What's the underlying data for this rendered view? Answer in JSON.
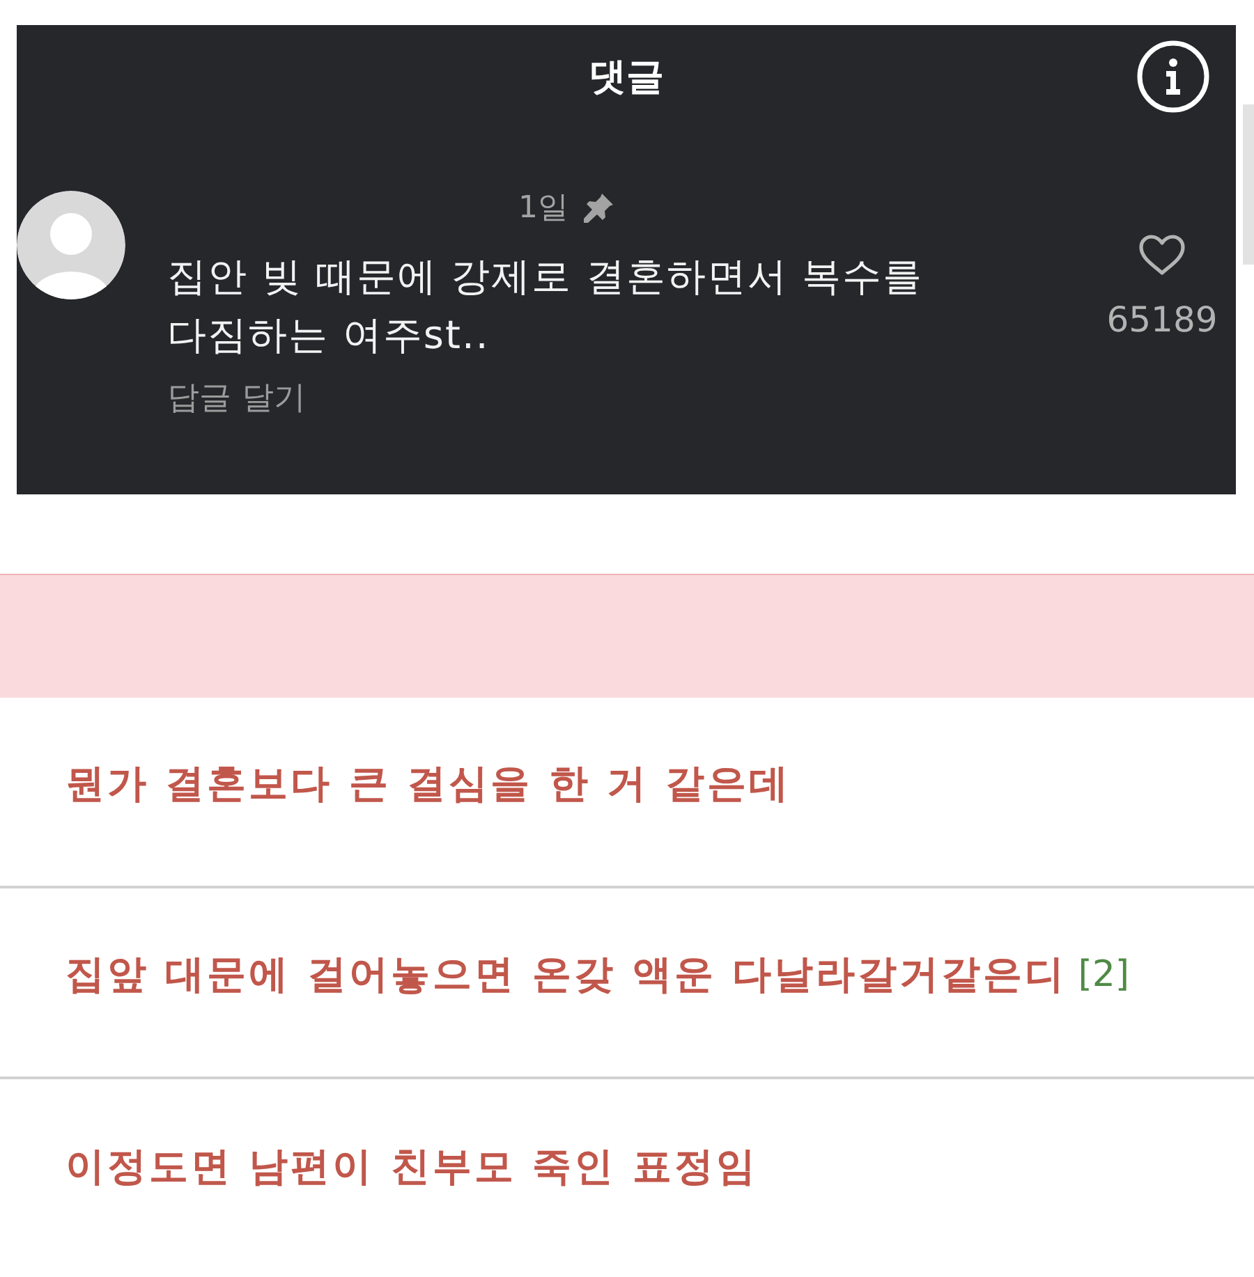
{
  "header": {
    "title": "댓글"
  },
  "comment": {
    "time": "1일",
    "pinned": true,
    "text": "집안 빚 때문에 강제로 결혼하면서 복수를 다짐하는 여주st..",
    "reply_link": "답글 달기",
    "liked": false,
    "likes": "65189"
  },
  "posts": [
    {
      "title": "뭔가 결혼보다 큰 결심을 한 거 같은데"
    },
    {
      "title": "집앞 대문에 걸어놓으면 온갖 액운 다날라갈거같은디",
      "comment_count": "[2]"
    },
    {
      "title": "이정도면 남편이 친부모 죽인 표정임"
    }
  ]
}
